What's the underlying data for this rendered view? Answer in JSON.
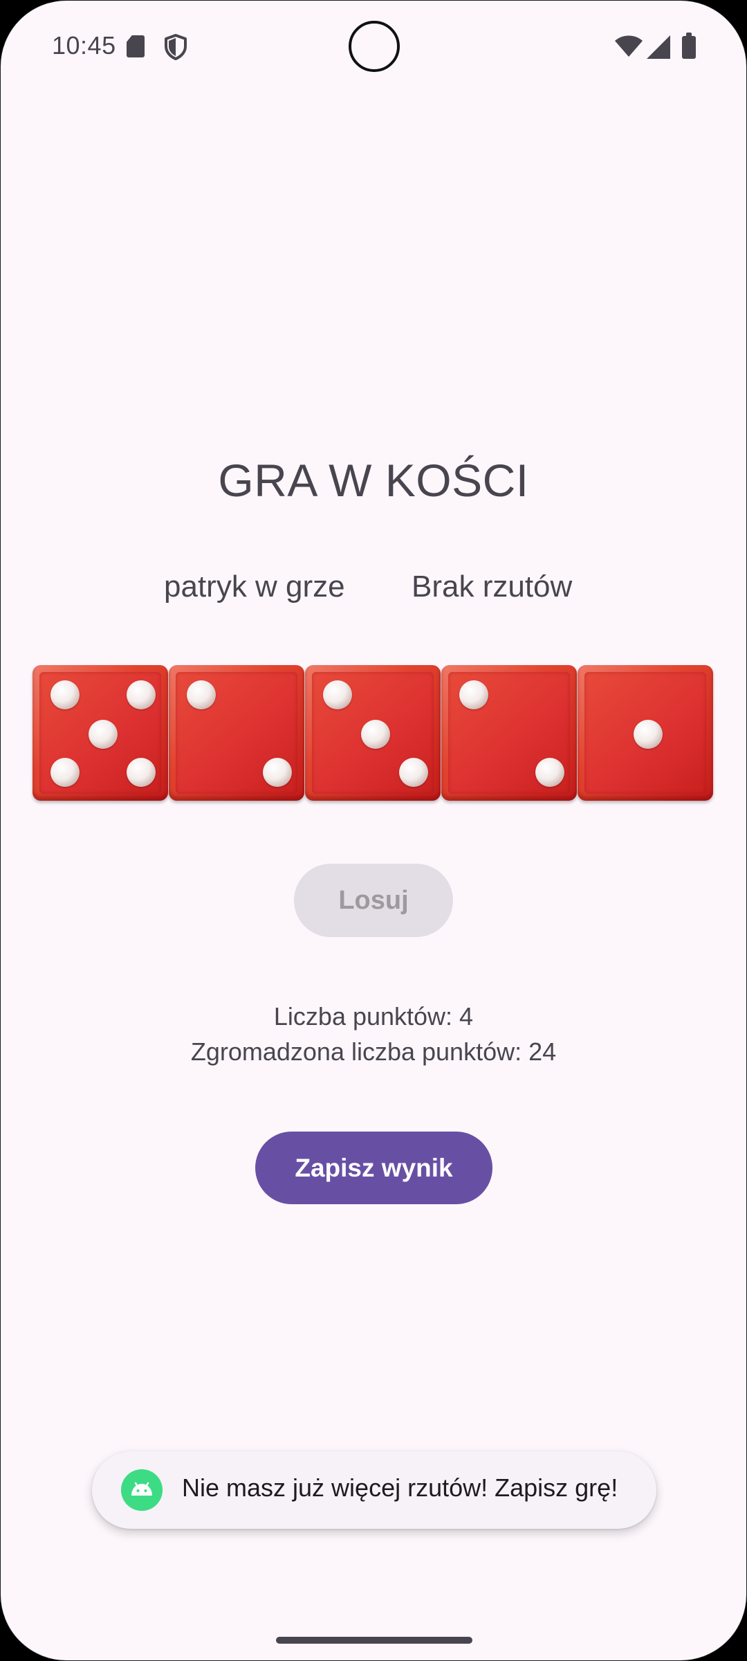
{
  "status_bar": {
    "time": "10:45",
    "icons": [
      "sd-card-icon",
      "shield-icon",
      "wifi-icon",
      "signal-icon",
      "battery-icon"
    ]
  },
  "game": {
    "title": "GRA W KOŚCI",
    "player_name": "patryk w grze",
    "throws_status": "Brak rzutów",
    "dice": [
      5,
      2,
      3,
      2,
      1
    ],
    "roll_button_label": "Losuj",
    "roll_button_enabled": false,
    "points_text": "Liczba punktów: 4",
    "total_points_text": "Zgromadzona liczba punktów: 24",
    "save_button_label": "Zapisz wynik"
  },
  "toast": {
    "message": "Nie masz już więcej rzutów! Zapisz grę!",
    "icon": "android-icon"
  },
  "colors": {
    "background": "#fdf7fc",
    "primary": "#6750a4",
    "die_red": "#e2432f",
    "disabled_button": "#e3dee5",
    "android_green": "#3ddc84"
  }
}
